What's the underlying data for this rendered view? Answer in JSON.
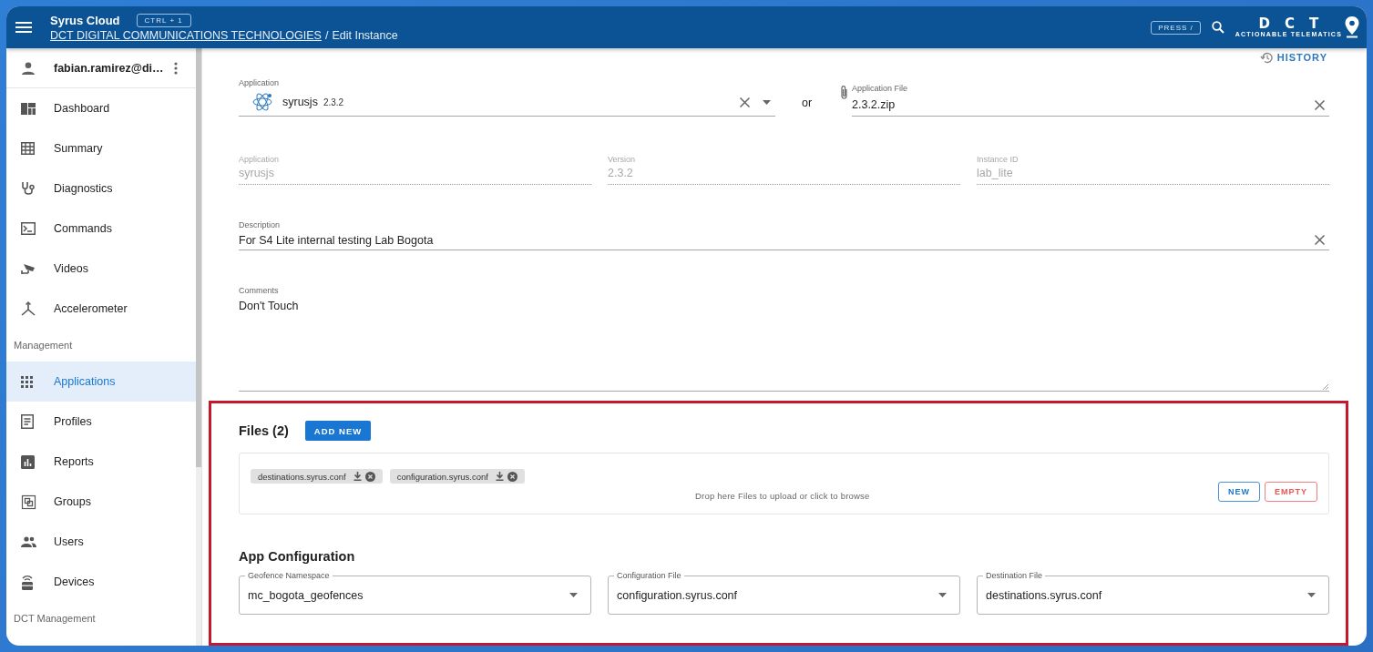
{
  "header": {
    "title": "Syrus Cloud",
    "shortcut": "CTRL + 1",
    "breadcrumb_link": "DCT DIGITAL COMMUNICATIONS TECHNOLOGIES",
    "breadcrumb_separator": "/",
    "breadcrumb_current": "Edit Instance",
    "search_shortcut": "PRESS /",
    "logo_wordmark": "DCT",
    "logo_tagline": "ACTIONABLE TELEMATICS"
  },
  "sidebar": {
    "user": "fabian.ramirez@di…",
    "items": [
      {
        "label": "Dashboard",
        "selected": false
      },
      {
        "label": "Summary",
        "selected": false
      },
      {
        "label": "Diagnostics",
        "selected": false
      },
      {
        "label": "Commands",
        "selected": false
      },
      {
        "label": "Videos",
        "selected": false
      },
      {
        "label": "Accelerometer",
        "selected": false
      }
    ],
    "groups": [
      {
        "heading": "Management",
        "items": [
          {
            "label": "Applications",
            "selected": true
          },
          {
            "label": "Profiles",
            "selected": false
          },
          {
            "label": "Reports",
            "selected": false
          },
          {
            "label": "Groups",
            "selected": false
          },
          {
            "label": "Users",
            "selected": false
          },
          {
            "label": "Devices",
            "selected": false
          }
        ]
      },
      {
        "heading": "DCT Management"
      }
    ]
  },
  "main": {
    "history_link": "HISTORY",
    "application_select": {
      "label": "Application",
      "value": "syrusjs",
      "version": "2.3.2"
    },
    "or_text": "or",
    "application_file": {
      "label": "Application File",
      "value": "2.3.2.zip"
    },
    "readonly_fields": [
      {
        "label": "Application",
        "value": "syrusjs",
        "disabled": true
      },
      {
        "label": "Version",
        "value": "2.3.2",
        "disabled": true
      },
      {
        "label": "Instance ID",
        "value": "lab_lite",
        "disabled": true
      }
    ],
    "description": {
      "label": "Description",
      "value": "For S4 Lite internal testing Lab Bogota"
    },
    "comments": {
      "label": "Comments",
      "value": "Don't Touch"
    },
    "files": {
      "title": "Files (2)",
      "add_button": "ADD NEW",
      "chips": [
        "destinations.syrus.conf",
        "configuration.syrus.conf"
      ],
      "drop_hint": "Drop here Files to upload or click to browse",
      "buttons": [
        {
          "label": "NEW",
          "kind": "primary"
        },
        {
          "label": "EMPTY",
          "kind": "danger"
        }
      ]
    },
    "app_configuration": {
      "title": "App Configuration",
      "selects": [
        {
          "label": "Geofence Namespace",
          "value": "mc_bogota_geofences"
        },
        {
          "label": "Configuration File",
          "value": "configuration.syrus.conf"
        },
        {
          "label": "Destination File",
          "value": "destinations.syrus.conf"
        }
      ]
    }
  }
}
